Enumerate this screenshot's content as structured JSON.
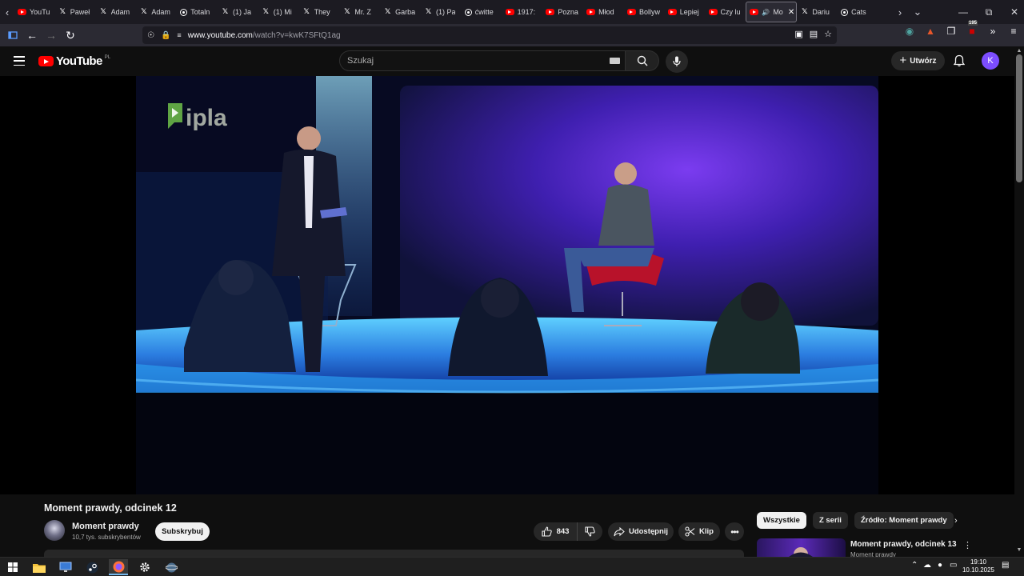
{
  "browser": {
    "tabs": [
      {
        "label": "YouTu",
        "icon": "youtube"
      },
      {
        "label": "Paweł",
        "icon": "x"
      },
      {
        "label": "Adam",
        "icon": "x"
      },
      {
        "label": "Adam",
        "icon": "x"
      },
      {
        "label": "Totaln",
        "icon": "threads"
      },
      {
        "label": "(1) Ja",
        "icon": "x"
      },
      {
        "label": "(1) Mi",
        "icon": "x"
      },
      {
        "label": "They",
        "icon": "x"
      },
      {
        "label": "Mr. Z",
        "icon": "x"
      },
      {
        "label": "Garba",
        "icon": "x"
      },
      {
        "label": "(1) Pa",
        "icon": "x"
      },
      {
        "label": "ćwitte",
        "icon": "threads"
      },
      {
        "label": "1917:",
        "icon": "youtube"
      },
      {
        "label": "Pozna",
        "icon": "youtube"
      },
      {
        "label": "Młod",
        "icon": "youtube"
      },
      {
        "label": "Bollyw",
        "icon": "youtube"
      },
      {
        "label": "Lepiej",
        "icon": "youtube"
      },
      {
        "label": "Czy lu",
        "icon": "youtube"
      },
      {
        "label": "Mo",
        "icon": "youtube",
        "active": true,
        "audio": true
      },
      {
        "label": "Dariu",
        "icon": "x"
      },
      {
        "label": "Cats",
        "icon": "threads"
      }
    ],
    "url_host": "www.youtube.com",
    "url_path": "/watch?v=kwK7SFtQ1ag",
    "extension_badge": "195"
  },
  "youtube": {
    "logo_text": "YouTube",
    "country_code": "PL",
    "search_placeholder": "Szukaj",
    "create_label": "Utwórz",
    "avatar_letter": "K"
  },
  "video": {
    "watermark": "ipla",
    "title": "Moment prawdy, odcinek 12",
    "channel_name": "Moment prawdy",
    "subscribers": "10,7 tys. subskrybentów",
    "subscribe_label": "Subskrybuj",
    "likes": "843",
    "share_label": "Udostępnij",
    "clip_label": "Klip"
  },
  "sidebar": {
    "chips": [
      "Wszystkie",
      "Z serii",
      "Źródło: Moment prawdy"
    ],
    "recommendation": {
      "title": "Moment prawdy, odcinek 13",
      "channel": "Moment prawdy"
    }
  },
  "taskbar": {
    "time": "19:10",
    "date": "10.10.2025"
  },
  "colors": {
    "youtube_red": "#ff0000",
    "avatar_purple": "#7c4dff",
    "browser_chrome": "#1c1b22",
    "page_bg": "#0f0f0f"
  }
}
